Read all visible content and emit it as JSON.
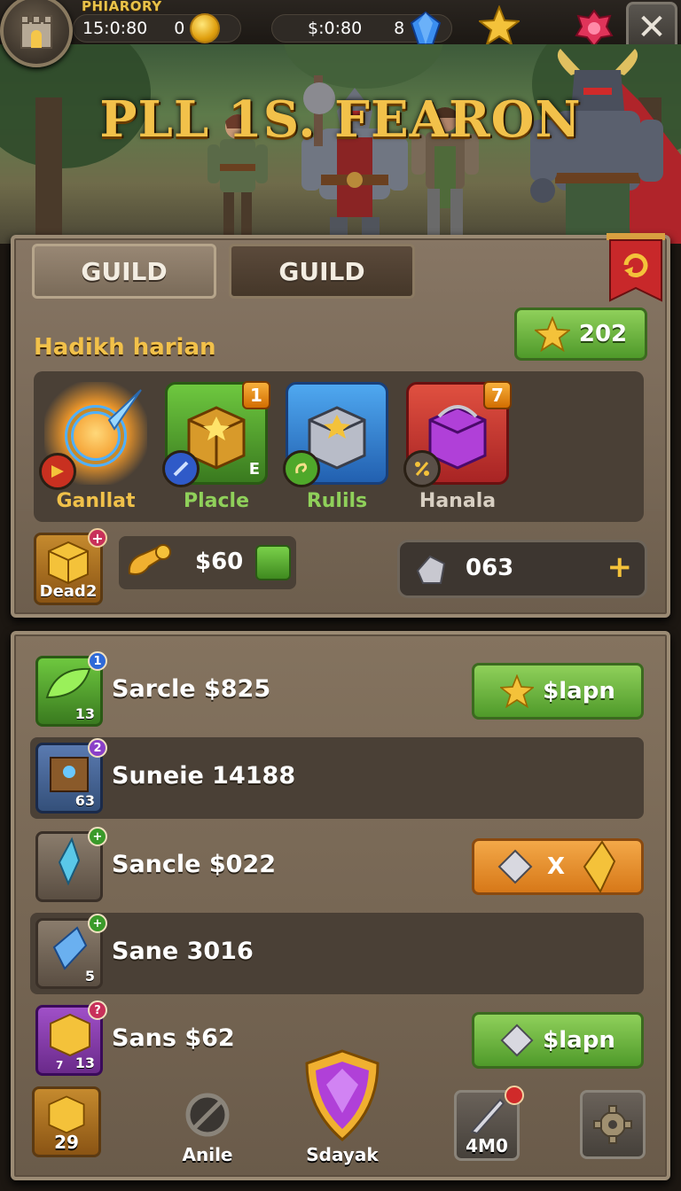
{
  "topbar": {
    "brand": "PHIARORY",
    "time": "15:0:80",
    "coins": "0",
    "money": "$:0:80",
    "gems": "8",
    "close_label": "✕"
  },
  "hero": {
    "title": "PLL 1S. FEARON"
  },
  "guild": {
    "tabs": [
      "GUILD",
      "GUILD"
    ],
    "section_label": "Hadikh harian",
    "stars_value": "202",
    "rewards": [
      {
        "name": "Ganllat",
        "badge": "",
        "color": "#f0c14a"
      },
      {
        "name": "Placle",
        "badge": "1",
        "color": "#8fd05a"
      },
      {
        "name": "Rulils",
        "badge": "",
        "color": "#8fd05a"
      },
      {
        "name": "Hanala",
        "badge": "7",
        "color": "#cfc4b6"
      }
    ],
    "place_tag": "E",
    "dead_label": "Dead2",
    "cost": "$60",
    "quantity": "063",
    "plus": "+"
  },
  "list": {
    "rows": [
      {
        "label": "Sarcle $825",
        "count": "13",
        "dot": "1",
        "action": "$lapn"
      },
      {
        "label": "Suneie 14188",
        "count": "63",
        "dot": "2",
        "action": ""
      },
      {
        "label": "Sancle $022",
        "count": "",
        "dot": "+",
        "action": "X"
      },
      {
        "label": "Sane 3016",
        "count": "5",
        "dot": "+",
        "action": ""
      },
      {
        "label": "Sans $62",
        "count": "13",
        "dot": "?",
        "action": "$lapn",
        "small": "7"
      }
    ]
  },
  "nav": {
    "items": [
      {
        "label": "29"
      },
      {
        "label": "Anile"
      },
      {
        "label": "Sdayak"
      },
      {
        "label": "4M0"
      },
      {
        "label": ""
      }
    ]
  },
  "colors": {
    "gold": "#f2c14a",
    "green": "#6fb83f",
    "orange": "#e78a2a",
    "panel": "#7a6a58"
  }
}
